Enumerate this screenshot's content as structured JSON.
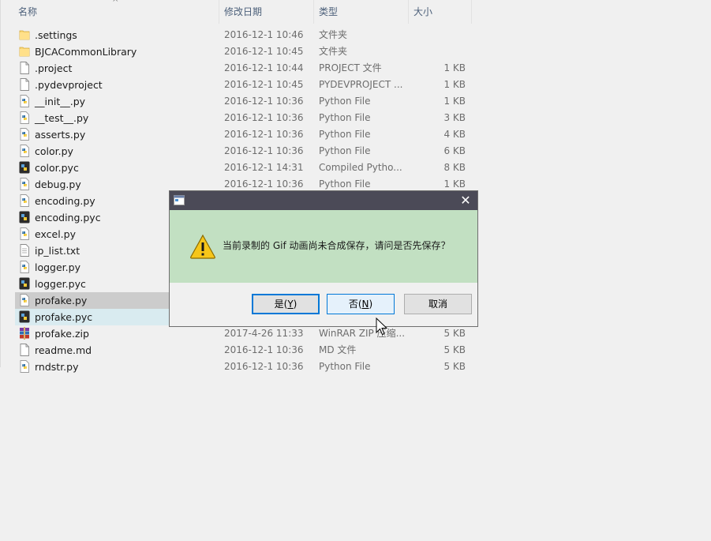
{
  "columns": {
    "name": "名称",
    "date": "修改日期",
    "type": "类型",
    "size": "大小"
  },
  "files": [
    {
      "icon": "folder-icon",
      "name": ".settings",
      "date": "2016-12-1 10:46",
      "type": "文件夹",
      "size": ""
    },
    {
      "icon": "folder-icon",
      "name": "BJCACommonLibrary",
      "date": "2016-12-1 10:45",
      "type": "文件夹",
      "size": ""
    },
    {
      "icon": "blank-file-icon",
      "name": ".project",
      "date": "2016-12-1 10:44",
      "type": "PROJECT 文件",
      "size": "1 KB"
    },
    {
      "icon": "blank-file-icon",
      "name": ".pydevproject",
      "date": "2016-12-1 10:45",
      "type": "PYDEVPROJECT ...",
      "size": "1 KB"
    },
    {
      "icon": "python-file-icon",
      "name": "__init__.py",
      "date": "2016-12-1 10:36",
      "type": "Python File",
      "size": "1 KB"
    },
    {
      "icon": "python-file-icon",
      "name": "__test__.py",
      "date": "2016-12-1 10:36",
      "type": "Python File",
      "size": "3 KB"
    },
    {
      "icon": "python-file-icon",
      "name": "asserts.py",
      "date": "2016-12-1 10:36",
      "type": "Python File",
      "size": "4 KB"
    },
    {
      "icon": "python-file-icon",
      "name": "color.py",
      "date": "2016-12-1 10:36",
      "type": "Python File",
      "size": "6 KB"
    },
    {
      "icon": "compiled-python-icon",
      "name": "color.pyc",
      "date": "2016-12-1 14:31",
      "type": "Compiled Pytho...",
      "size": "8 KB"
    },
    {
      "icon": "python-file-icon",
      "name": "debug.py",
      "date": "2016-12-1 10:36",
      "type": "Python File",
      "size": "1 KB"
    },
    {
      "icon": "python-file-icon",
      "name": "encoding.py",
      "date": "",
      "type": "",
      "size": ""
    },
    {
      "icon": "compiled-python-icon",
      "name": "encoding.pyc",
      "date": "",
      "type": "",
      "size": ""
    },
    {
      "icon": "python-file-icon",
      "name": "excel.py",
      "date": "",
      "type": "",
      "size": ""
    },
    {
      "icon": "text-file-icon",
      "name": "ip_list.txt",
      "date": "",
      "type": "",
      "size": ""
    },
    {
      "icon": "python-file-icon",
      "name": "logger.py",
      "date": "",
      "type": "",
      "size": ""
    },
    {
      "icon": "compiled-python-icon",
      "name": "logger.pyc",
      "date": "",
      "type": "",
      "size": ""
    },
    {
      "icon": "python-file-icon",
      "name": "profake.py",
      "date": "",
      "type": "",
      "size": "",
      "state": "selected"
    },
    {
      "icon": "compiled-python-icon",
      "name": "profake.pyc",
      "date": "",
      "type": "",
      "size": "",
      "state": "hover"
    },
    {
      "icon": "winrar-icon",
      "name": "profake.zip",
      "date": "2017-4-26 11:33",
      "type": "WinRAR ZIP 压缩...",
      "size": "5 KB"
    },
    {
      "icon": "blank-file-icon",
      "name": "readme.md",
      "date": "2016-12-1 10:36",
      "type": "MD 文件",
      "size": "5 KB"
    },
    {
      "icon": "python-file-icon",
      "name": "rndstr.py",
      "date": "2016-12-1 10:36",
      "type": "Python File",
      "size": "5 KB"
    }
  ],
  "dialog": {
    "message": "当前录制的 Gif 动画尚未合成保存，请问是否先保存？",
    "yes": {
      "label": "是(",
      "mnemonic": "Y",
      "suffix": ")"
    },
    "no": {
      "label": "否(",
      "mnemonic": "N",
      "suffix": ")"
    },
    "cancel": "取消",
    "icons": {
      "title": "app-icon",
      "warning": "warning-icon",
      "close": "close-icon"
    }
  },
  "colors": {
    "header_text": "#4c607a",
    "dialog_title_bg": "#4b4a57",
    "dialog_body_bg": "#c2e0c2",
    "selected_row": "#cccccc",
    "hover_row": "#d9ebf0",
    "accent": "#0078d7"
  }
}
